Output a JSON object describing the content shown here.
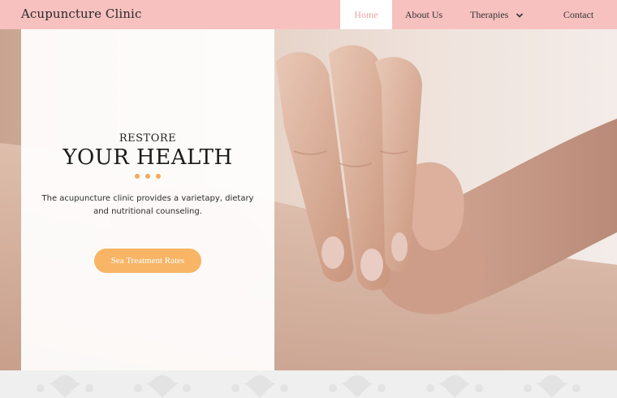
{
  "header": {
    "brand": "Acupuncture Clinic",
    "nav": [
      {
        "label": "Home",
        "active": true
      },
      {
        "label": "About Us",
        "active": false
      },
      {
        "label": "Therapies",
        "active": false,
        "has_dropdown": true
      },
      {
        "label": "Contact",
        "active": false
      }
    ],
    "dropdown_icon": "chevron-down-icon"
  },
  "hero": {
    "eyebrow": "RESTORE",
    "headline": "YOUR HEALTH",
    "description": "The acupuncture clinic provides a varietapy, dietary and nutritional counseling.",
    "cta_label": "Sea Treatment Rates",
    "image": "hands-massage-photo"
  },
  "colors": {
    "header_bg": "#f7c1bf",
    "active_nav_text": "#e9a7a5",
    "accent": "#f4a85e",
    "button_bg": "#f7b565"
  }
}
